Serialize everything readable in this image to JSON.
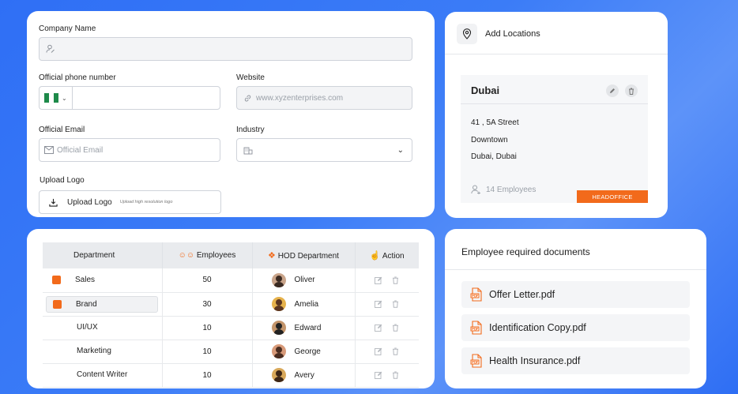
{
  "form": {
    "company_name_label": "Company Name",
    "phone_label": "Official phone number",
    "website_label": "Website",
    "website_placeholder": "www.xyzenterprises.com",
    "email_label": "Official Email",
    "email_placeholder": "Official Email",
    "industry_label": "Industry",
    "upload_logo_label": "Upload Logo",
    "upload_button_label": "Upload Logo",
    "upload_hint": "Upload high resolution logo"
  },
  "locations": {
    "header": "Add Locations",
    "city": "Dubai",
    "address_line1": "41 , 5A Street",
    "address_line2": "Downtown",
    "address_line3": "Dubai, Dubai",
    "employees": "14 Employees",
    "badge": "HEADOFFICE"
  },
  "table": {
    "headers": [
      "Department",
      "Employees",
      "HOD Department",
      "Action"
    ],
    "rows": [
      {
        "dept": "Sales",
        "count": "50",
        "hod": "Oliver",
        "square": true
      },
      {
        "dept": "Brand",
        "count": "30",
        "hod": "Amelia",
        "square": true
      },
      {
        "dept": "UI/UX",
        "count": "10",
        "hod": "Edward",
        "square": false
      },
      {
        "dept": "Marketing",
        "count": "10",
        "hod": "George",
        "square": false
      },
      {
        "dept": "Content Writer",
        "count": "10",
        "hod": "Avery",
        "square": false
      }
    ]
  },
  "documents": {
    "title": "Employee required documents",
    "items": [
      "Offer Letter.pdf",
      "Identification Copy.pdf",
      "Health Insurance.pdf"
    ]
  },
  "colors": {
    "accent": "#f26a1b",
    "background": "#2f6ff5"
  }
}
